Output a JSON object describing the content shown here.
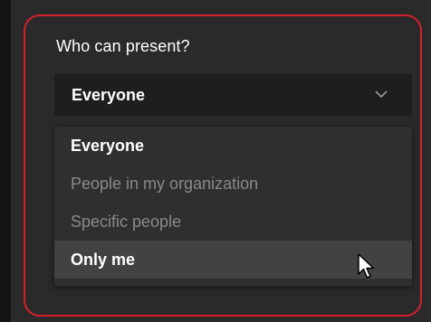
{
  "dialog": {
    "title": "Who can present?"
  },
  "select": {
    "selected_value": "Everyone",
    "expanded": true
  },
  "menu": {
    "items": [
      {
        "label": "Everyone",
        "state": "selected"
      },
      {
        "label": "People in my organization",
        "state": "disabled"
      },
      {
        "label": "Specific people",
        "state": "disabled"
      },
      {
        "label": "Only me",
        "state": "hovered"
      }
    ]
  },
  "colors": {
    "highlight_border": "#d7202b",
    "background": "#2a2a2a",
    "select_background": "#1e1e1e",
    "menu_background": "#2f2f2f",
    "hover_background": "#424242",
    "primary_text": "#ffffff",
    "disabled_text": "#8a8a8a"
  },
  "icons": {
    "chevron": "chevron-down-icon",
    "cursor": "mouse-pointer-icon"
  }
}
